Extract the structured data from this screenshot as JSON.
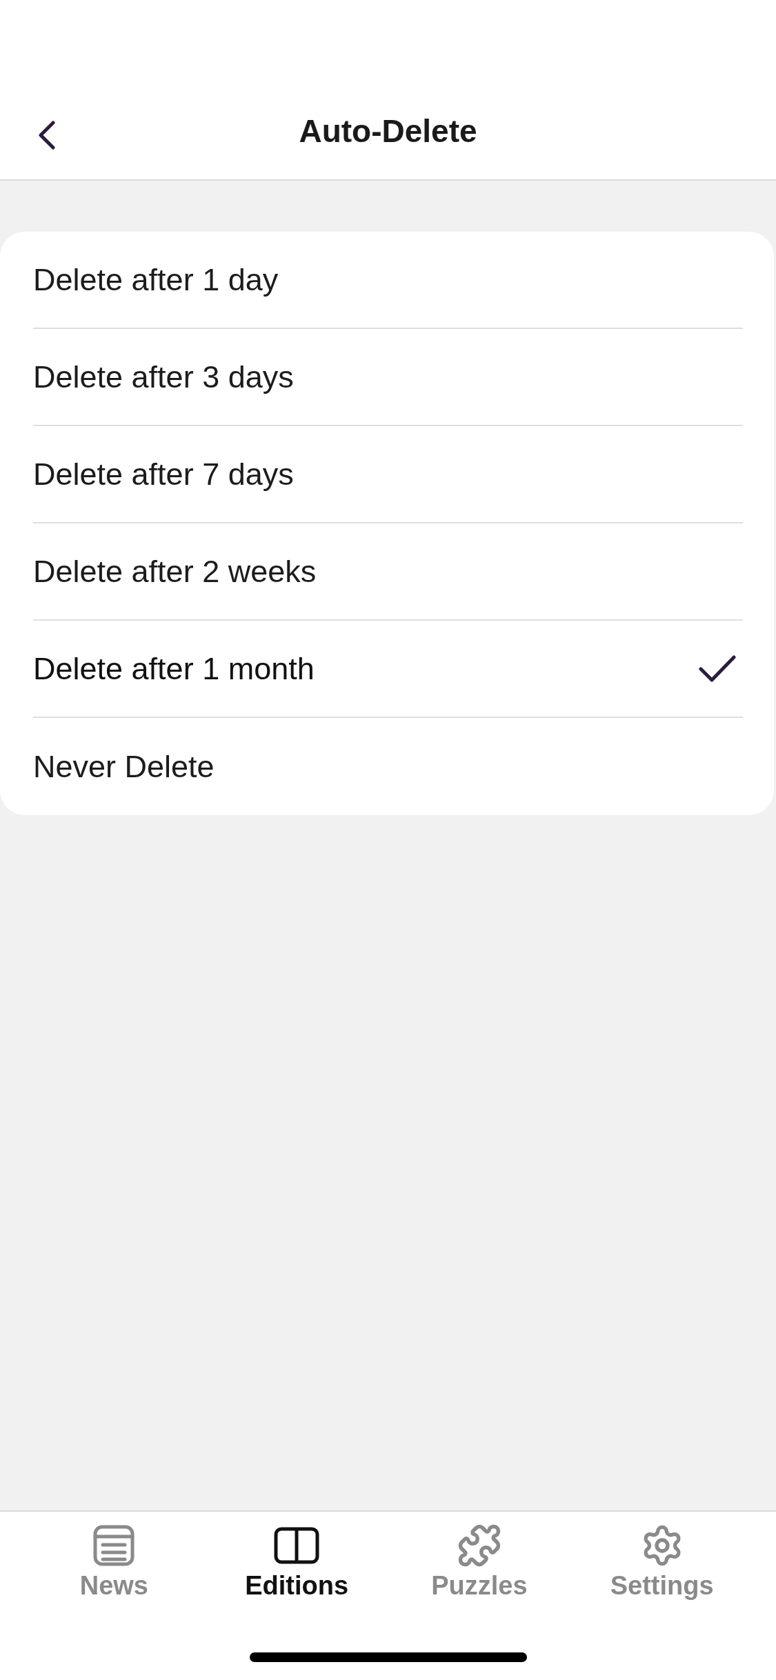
{
  "header": {
    "title": "Auto-Delete"
  },
  "options": [
    {
      "label": "Delete after 1 day",
      "selected": false
    },
    {
      "label": "Delete after 3 days",
      "selected": false
    },
    {
      "label": "Delete after 7 days",
      "selected": false
    },
    {
      "label": "Delete after 2 weeks",
      "selected": false
    },
    {
      "label": "Delete after 1 month",
      "selected": true
    },
    {
      "label": "Never Delete",
      "selected": false
    }
  ],
  "tab_bar": [
    {
      "label": "News",
      "selected": false
    },
    {
      "label": "Editions",
      "selected": true
    },
    {
      "label": "Puzzles",
      "selected": false
    },
    {
      "label": "Settings",
      "selected": false
    }
  ]
}
